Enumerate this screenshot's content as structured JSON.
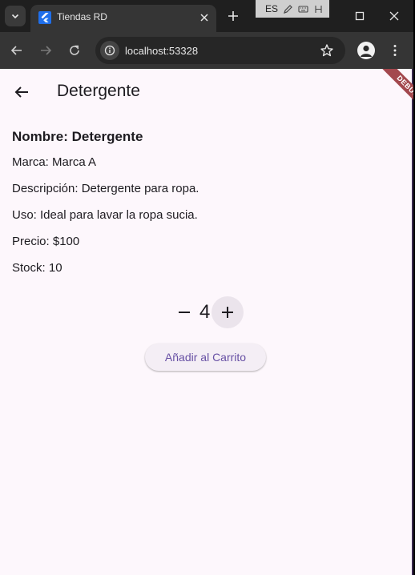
{
  "browser": {
    "tab_title": "Tiendas RD",
    "url": "localhost:53328",
    "tray_lang": "ES"
  },
  "app": {
    "title": "Detergente",
    "debug_label": "DEBUG"
  },
  "product": {
    "name_line": "Nombre: Detergente",
    "brand_line": "Marca: Marca A",
    "description_line": "Descripción: Detergente para ropa.",
    "use_line": "Uso: Ideal para lavar la ropa sucia.",
    "price_line": "Precio: $100",
    "stock_line": "Stock: 10"
  },
  "quantity": {
    "value": "4"
  },
  "actions": {
    "add_to_cart": "Añadir al Carrito"
  },
  "colors": {
    "accent": "#6750a4",
    "page_bg": "#fdf7fc",
    "debug_ribbon": "#a3484e"
  }
}
